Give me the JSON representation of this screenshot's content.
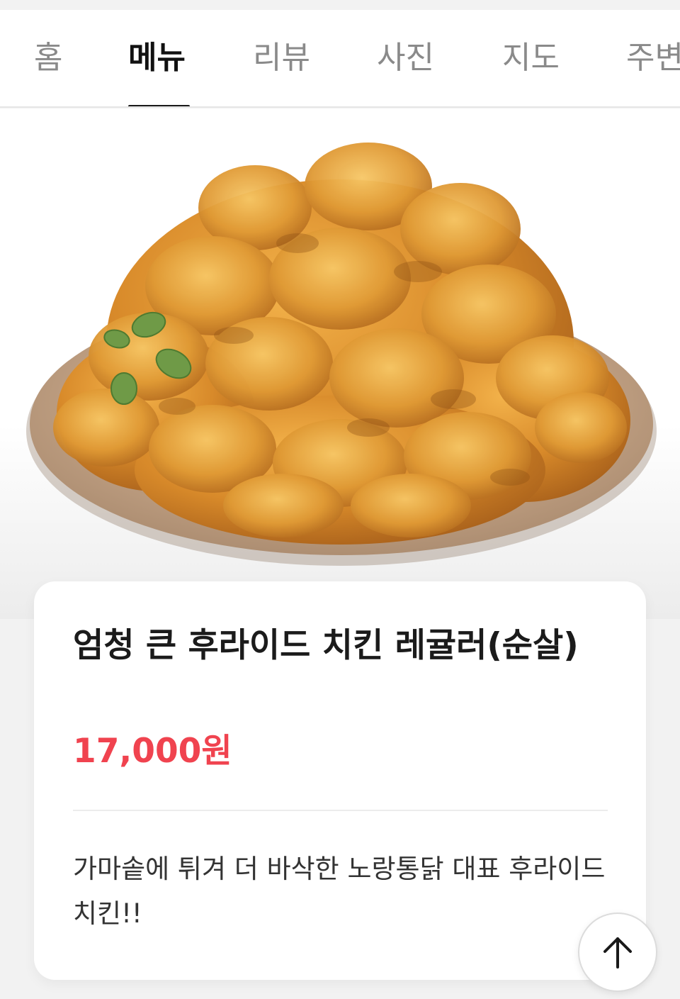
{
  "tabs": [
    {
      "label": "홈",
      "active": false
    },
    {
      "label": "메뉴",
      "active": true
    },
    {
      "label": "리뷰",
      "active": false
    },
    {
      "label": "사진",
      "active": false
    },
    {
      "label": "지도",
      "active": false
    },
    {
      "label": "주변",
      "active": false
    }
  ],
  "menu": {
    "name": "엄청 큰 후라이드 치킨 레귤러(순살)",
    "price": "17,000원",
    "description": "가마솥에 튀겨 더 바삭한 노랑통닭 대표 후라이드 치킨!!"
  },
  "icons": {
    "scroll_top": "arrow-up-icon"
  },
  "colors": {
    "price": "#f0434f",
    "active_tab": "#111111",
    "inactive_tab": "#8a8a8a"
  }
}
